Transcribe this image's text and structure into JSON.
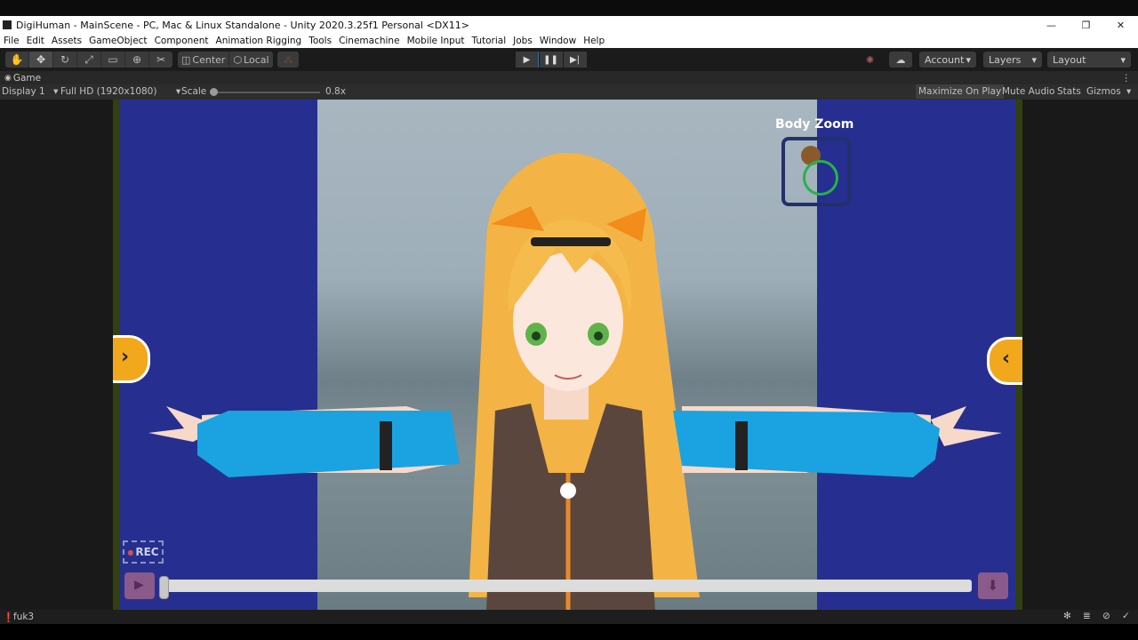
{
  "window": {
    "title": "DigiHuman - MainScene - PC, Mac & Linux Standalone - Unity 2020.3.25f1 Personal <DX11>",
    "controls": [
      "—",
      "❐",
      "✕"
    ]
  },
  "menu": [
    "File",
    "Edit",
    "Assets",
    "GameObject",
    "Component",
    "Animation Rigging",
    "Tools",
    "Cinemachine",
    "Mobile Input",
    "Tutorial",
    "Jobs",
    "Window",
    "Help"
  ],
  "toolbar": {
    "pivot_label": "Center",
    "space_label": "Local",
    "account_label": "Account",
    "layers_label": "Layers",
    "layout_label": "Layout"
  },
  "game_view": {
    "tab_label": "Game",
    "display": "Display 1",
    "resolution": "Full HD (1920x1080)",
    "scale_label": "Scale",
    "scale_value": "0.8x",
    "maximize": "Maximize On Play",
    "mute": "Mute Audio",
    "stats": "Stats",
    "gizmos": "Gizmos"
  },
  "scene": {
    "body_zoom_label": "Body Zoom",
    "rec_label": "REC",
    "timeline_progress": 0
  },
  "status": {
    "message": "fuk3"
  },
  "colors": {
    "viewport_bg": "#262f8f",
    "arrow_button": "#f2a81c",
    "play_active": "#2f6ea8"
  }
}
